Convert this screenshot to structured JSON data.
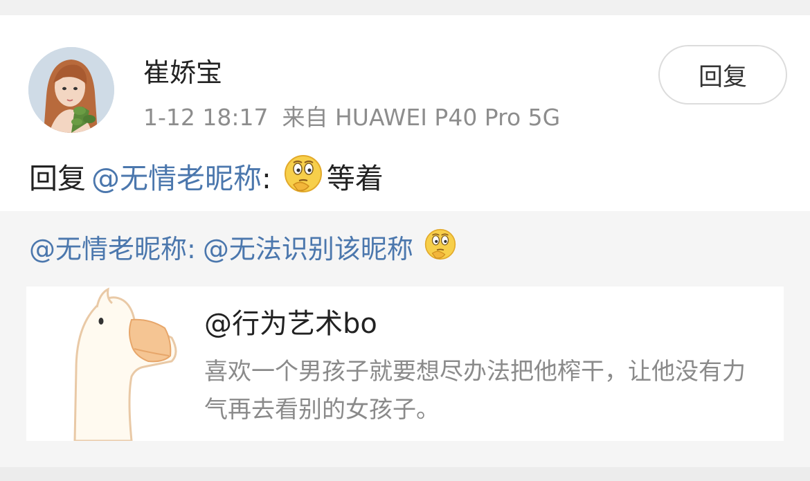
{
  "post": {
    "username": "崔娇宝",
    "time": "1-12 18:17",
    "source": "来自 HUAWEI P40 Pro 5G",
    "reply_button": "回复",
    "reply_prefix": "回复",
    "reply_mention": "@无情老昵称",
    "reply_colon": ":",
    "reply_text": "等着",
    "emoji_icon": "thinking-face-icon"
  },
  "quote": {
    "mention": "@无情老昵称",
    "colon": ":",
    "mention2": "@无法识别该昵称",
    "emoji_icon": "thinking-face-icon"
  },
  "share_card": {
    "title": "@行为艺术bo",
    "description": "喜欢一个男孩子就要想尽办法把他榨干，让他没有力气再去看别的女孩子。"
  },
  "colors": {
    "link": "#4b77ad",
    "meta": "#8d8d8d",
    "background": "#f1f1f1"
  }
}
